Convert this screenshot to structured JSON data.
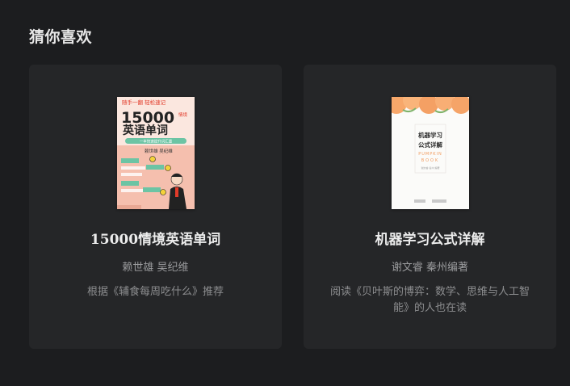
{
  "section": {
    "title": "猜你喜欢"
  },
  "books": [
    {
      "title": "15000情境英语单词",
      "author": "赖世雄 吴纪维",
      "reason": "根据《辅食每周吃什么》推荐",
      "cover": {
        "top_line": "随手一翻 轻松速记",
        "big_number": "15000",
        "side_text": "情境",
        "main_title": "英语单词",
        "banner": "一本快速提升词汇量",
        "authors": "赖世雄 吴纪维",
        "colors": {
          "background": "#f5bfae",
          "accent": "#e23b2a",
          "banner": "#6cc4a4"
        }
      }
    },
    {
      "title": "机器学习公式详解",
      "author": "谢文睿 秦州编著",
      "reason": "阅读《贝叶斯的博弈：数学、思维与人工智能》的人也在读",
      "cover": {
        "title_line1": "机器学习",
        "title_line2": "公式详解",
        "subtitle_line1": "PUMPKIN",
        "subtitle_line2": "BOOK",
        "authors": "谢文睿 秦州 编著",
        "colors": {
          "background": "#fbfbf9",
          "fruit": "#f7a76a",
          "subtitle": "#f29a5c"
        }
      }
    }
  ]
}
